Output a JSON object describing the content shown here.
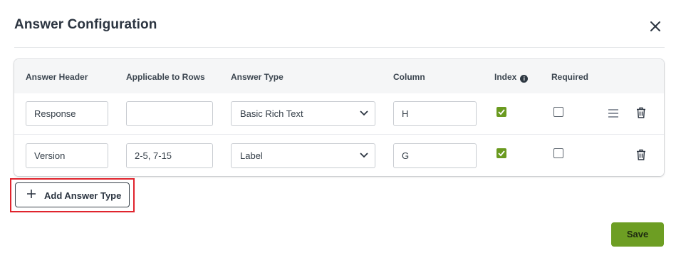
{
  "dialog": {
    "title": "Answer Configuration",
    "close_icon": "close-icon"
  },
  "table": {
    "headers": {
      "answer_header": "Answer Header",
      "applicable_rows": "Applicable to Rows",
      "answer_type": "Answer Type",
      "column": "Column",
      "index": "Index",
      "required": "Required"
    },
    "index_info_icon": "info-icon",
    "rows": [
      {
        "answer_header": "Response",
        "applicable_rows": "",
        "answer_type": "Basic Rich Text",
        "column": "H",
        "index": true,
        "required": false,
        "actions": [
          "drag-handle-icon",
          "trash-icon"
        ]
      },
      {
        "answer_header": "Version",
        "applicable_rows": "2-5, 7-15",
        "answer_type": "Label",
        "column": "G",
        "index": true,
        "required": false,
        "actions": [
          "trash-icon"
        ]
      }
    ]
  },
  "add_button": {
    "label": "Add Answer Type",
    "icon": "plus-icon"
  },
  "save_button": {
    "label": "Save"
  },
  "colors": {
    "accent_green": "#6d9e23",
    "highlight_red": "#e0242d"
  }
}
